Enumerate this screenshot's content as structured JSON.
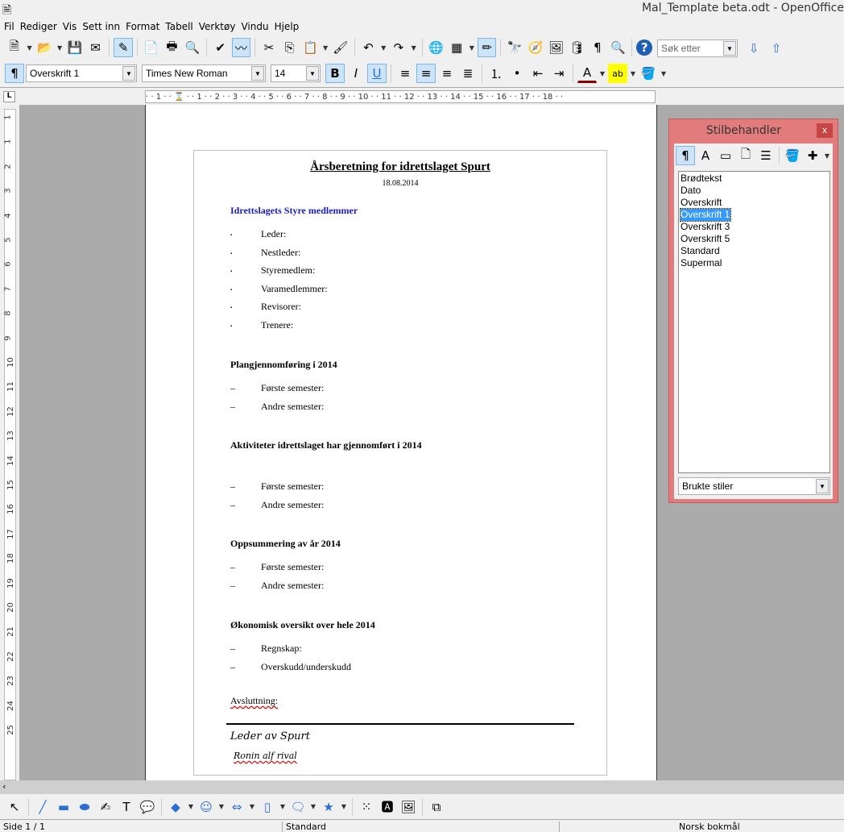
{
  "window": {
    "title": "Mal_Template beta.odt - OpenOffice"
  },
  "menu": [
    "Fil",
    "Rediger",
    "Vis",
    "Sett inn",
    "Format",
    "Tabell",
    "Verktøy",
    "Vindu",
    "Hjelp"
  ],
  "toolbar1": [
    {
      "icon": "new-document-icon",
      "g": "🗎",
      "dd": true
    },
    {
      "icon": "open-folder-icon",
      "g": "📂",
      "dd": true
    },
    {
      "icon": "save-icon",
      "g": "💾"
    },
    {
      "icon": "email-icon",
      "g": "✉"
    },
    {
      "sep": true
    },
    {
      "icon": "edit-mode-icon",
      "g": "✎",
      "on": true
    },
    {
      "sep": true
    },
    {
      "icon": "export-pdf-icon",
      "g": "📄"
    },
    {
      "icon": "print-icon",
      "g": "🖶"
    },
    {
      "icon": "print-preview-icon",
      "g": "🔍"
    },
    {
      "sep": true
    },
    {
      "icon": "spellcheck-icon",
      "g": "✔"
    },
    {
      "icon": "autospellcheck-icon",
      "g": "〰",
      "on": true
    },
    {
      "sep": true
    },
    {
      "icon": "cut-icon",
      "g": "✂"
    },
    {
      "icon": "copy-icon",
      "g": "⎘"
    },
    {
      "icon": "paste-icon",
      "g": "📋",
      "dd": true
    },
    {
      "icon": "format-paintbrush-icon",
      "g": "🖌"
    },
    {
      "sep": true
    },
    {
      "icon": "undo-icon",
      "g": "↶",
      "dd": true
    },
    {
      "icon": "redo-icon",
      "g": "↷",
      "dd": true
    },
    {
      "sep": true
    },
    {
      "icon": "hyperlink-icon",
      "g": "🌐"
    },
    {
      "icon": "table-icon",
      "g": "▦",
      "dd": true
    },
    {
      "icon": "draw-functions-icon",
      "g": "✏",
      "on": true
    },
    {
      "sep": true
    },
    {
      "icon": "find-replace-icon",
      "g": "🔭"
    },
    {
      "icon": "navigator-icon",
      "g": "🧭"
    },
    {
      "icon": "gallery-icon",
      "g": "🖼"
    },
    {
      "icon": "data-sources-icon",
      "g": "🛢"
    },
    {
      "icon": "formatting-marks-icon",
      "g": "¶"
    },
    {
      "icon": "zoom-icon",
      "g": "🔍"
    },
    {
      "sep": true
    },
    {
      "icon": "help-icon",
      "g": "?"
    }
  ],
  "search": {
    "placeholder": "Søk etter"
  },
  "format": {
    "style": "Overskrift 1",
    "font": "Times New Roman",
    "size": "14"
  },
  "toolbar2": [
    {
      "icon": "bold-icon",
      "g": "B",
      "on": true
    },
    {
      "icon": "italic-icon",
      "g": "I"
    },
    {
      "icon": "underline-icon",
      "g": "U",
      "on": true
    },
    {
      "sep": true
    },
    {
      "icon": "align-left-icon",
      "g": "≡"
    },
    {
      "icon": "align-center-icon",
      "g": "≡",
      "on": true
    },
    {
      "icon": "align-right-icon",
      "g": "≡"
    },
    {
      "icon": "justify-icon",
      "g": "≣"
    },
    {
      "sep": true
    },
    {
      "icon": "numbering-icon",
      "g": "⒈"
    },
    {
      "icon": "bullets-icon",
      "g": "•"
    },
    {
      "icon": "decrease-indent-icon",
      "g": "⇤"
    },
    {
      "icon": "increase-indent-icon",
      "g": "⇥"
    },
    {
      "sep": true
    },
    {
      "icon": "font-color-icon",
      "g": "A",
      "dd": true
    },
    {
      "icon": "highlight-icon",
      "g": "ab",
      "dd": true
    },
    {
      "icon": "background-color-icon",
      "g": "🪣",
      "dd": true
    }
  ],
  "ruler": {
    "h": "· · 1 · · ⌛ · · 1 · · 2 · · 3 · · 4 · · 5 · · 6 · · 7 · · 8 · · 9 · · 10 · · 11 · · 12 · · 13 · · 14 · · 15 · · 16 · · 17 · · 18 · ·",
    "v": [
      "1",
      "1",
      "2",
      "3",
      "4",
      "5",
      "6",
      "7",
      "8",
      "9",
      "10",
      "11",
      "12",
      "13",
      "14",
      "15",
      "16",
      "17",
      "18",
      "19",
      "20",
      "21",
      "22",
      "23",
      "24",
      "25"
    ]
  },
  "document": {
    "title": "Årsberetning for idrettslaget Spurt",
    "date": "18.08.2014",
    "section1": {
      "heading": "Idrettslagets Styre medlemmer",
      "items": [
        "Leder:",
        "Nestleder:",
        "Styremedlem:",
        "Varamedlemmer:",
        "Revisorer:",
        "Trenere:"
      ]
    },
    "section2": {
      "heading": "Plangjennomføring i 2014",
      "items": [
        "Første semester:",
        "Andre semester:"
      ]
    },
    "section3": {
      "heading": "Aktiviteter idrettslaget har gjennomført i 2014",
      "items": [
        "Første semester:",
        "Andre semester:"
      ]
    },
    "section4": {
      "heading": "Oppsummering av år 2014",
      "items": [
        "Første semester:",
        "Andre semester:"
      ]
    },
    "section5": {
      "heading": "Økonomisk oversikt over hele 2014",
      "items": [
        "Regnskap:",
        "Overskudd/underskudd"
      ]
    },
    "closing": "Avsluttning:",
    "signature_title": "Leder av Spurt",
    "signature_name": "Ronin alf rival",
    "heading_color": "#1a1acc"
  },
  "stylist": {
    "title": "Stilbehandler",
    "close": "x",
    "styles": [
      "Brødtekst",
      "Dato",
      "Overskrift",
      "Overskrift 1",
      "Overskrift 3",
      "Overskrift 5",
      "Standard",
      "Supermal"
    ],
    "selected": "Overskrift 1",
    "filter": "Brukte stiler",
    "icons": [
      {
        "icon": "paragraph-styles-icon",
        "g": "¶",
        "on": true
      },
      {
        "icon": "character-styles-icon",
        "g": "A"
      },
      {
        "icon": "frame-styles-icon",
        "g": "▭"
      },
      {
        "icon": "page-styles-icon",
        "g": "🗋"
      },
      {
        "icon": "list-styles-icon",
        "g": "☰"
      },
      {
        "sep": true
      },
      {
        "icon": "fill-format-icon",
        "g": "🪣"
      },
      {
        "icon": "new-style-icon",
        "g": "✚",
        "dd": true
      }
    ]
  },
  "drawtoolbar": [
    {
      "icon": "select-icon",
      "g": "↖"
    },
    {
      "sep": true
    },
    {
      "icon": "line-icon",
      "g": "╱"
    },
    {
      "icon": "rectangle-icon",
      "g": "▬"
    },
    {
      "icon": "ellipse-icon",
      "g": "⬬"
    },
    {
      "icon": "freeform-icon",
      "g": "✍"
    },
    {
      "icon": "text-icon",
      "g": "T"
    },
    {
      "icon": "callout-icon",
      "g": "💬"
    },
    {
      "sep": true
    },
    {
      "icon": "basic-shapes-icon",
      "g": "◆",
      "dd": true
    },
    {
      "icon": "symbol-shapes-icon",
      "g": "☺",
      "dd": true
    },
    {
      "icon": "block-arrows-icon",
      "g": "⇔",
      "dd": true
    },
    {
      "icon": "flowchart-icon",
      "g": "▯",
      "dd": true
    },
    {
      "icon": "callouts-icon",
      "g": "🗨",
      "dd": true
    },
    {
      "icon": "stars-icon",
      "g": "★",
      "dd": true
    },
    {
      "sep": true
    },
    {
      "icon": "points-icon",
      "g": "⁙"
    },
    {
      "icon": "fontwork-icon",
      "g": "🅰"
    },
    {
      "icon": "from-file-icon",
      "g": "🖼"
    },
    {
      "sep": true
    },
    {
      "icon": "extrusion-icon",
      "g": "⧉"
    }
  ],
  "status": {
    "page": "Side 1 / 1",
    "style": "Standard",
    "language": "Norsk bokmål"
  }
}
